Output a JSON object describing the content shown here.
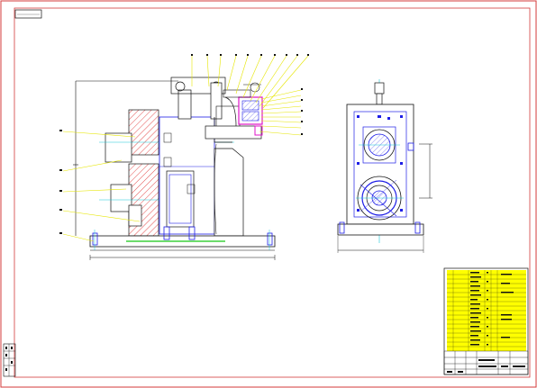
{
  "title_block_label": "",
  "colors": {
    "background": "#ffffff",
    "outer_border": "#d33b3b",
    "frame": "#000000",
    "leader": "#e6e600",
    "part_blue": "#1e1ee6",
    "part_magenta": "#e014c8",
    "hatch_red": "#dd2222",
    "centerline_cyan": "#18c8d8",
    "ground_green": "#14c814",
    "yellow_table": "#ffff00"
  },
  "icons": [
    "drawing-frame",
    "front-view",
    "side-view",
    "title-block",
    "revision-stamp"
  ]
}
